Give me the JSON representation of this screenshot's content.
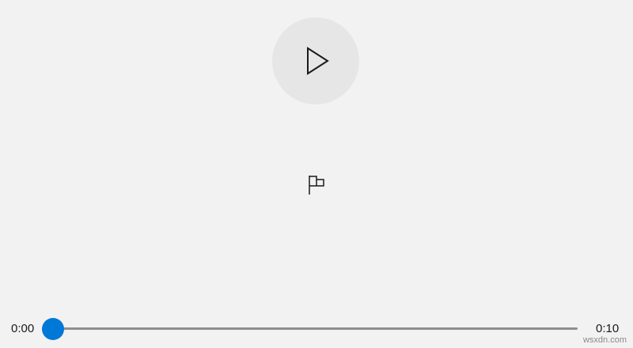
{
  "player": {
    "play_icon": "play-icon",
    "marker_icon": "flag-icon",
    "accent_color": "#0078d7"
  },
  "timeline": {
    "current_time": "0:00",
    "total_time": "0:10",
    "progress": 0
  },
  "watermark": "wsxdn.com"
}
